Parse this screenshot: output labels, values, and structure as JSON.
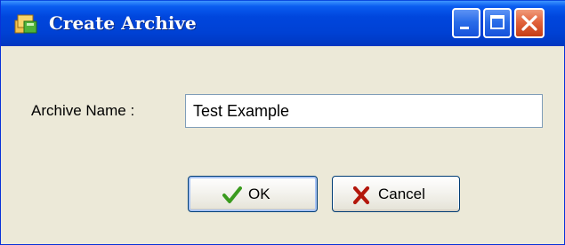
{
  "window": {
    "title": "Create Archive",
    "icon": "archive-app-icon"
  },
  "titlebar_buttons": {
    "minimize": "minimize-icon",
    "maximize": "maximize-icon",
    "close": "close-icon"
  },
  "form": {
    "archive_name_label": "Archive Name :",
    "archive_name_value": "Test Example"
  },
  "buttons": {
    "ok_label": "OK",
    "ok_icon": "checkmark-icon",
    "cancel_label": "Cancel",
    "cancel_icon": "x-mark-icon"
  },
  "colors": {
    "titlebar": "#0046dd",
    "window_face": "#ece9d8",
    "close_button": "#e2643d",
    "ok_check": "#3a9b1e",
    "cancel_x": "#b3170c"
  }
}
